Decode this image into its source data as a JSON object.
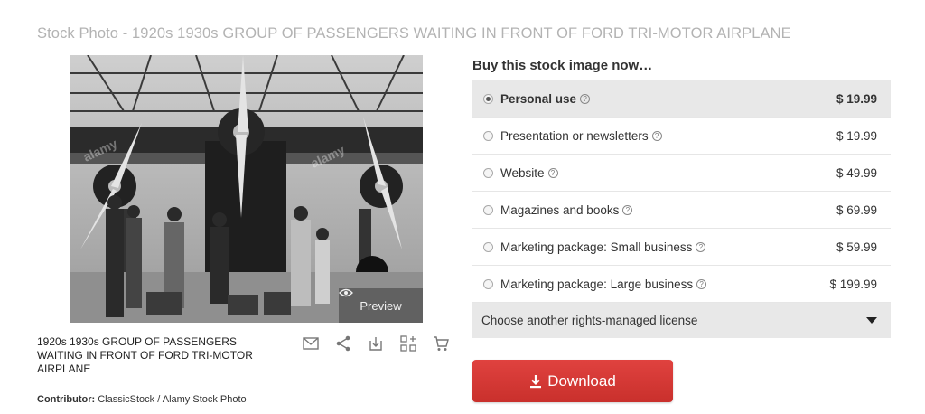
{
  "page": {
    "title": "Stock Photo - 1920s 1930s GROUP OF PASSENGERS WAITING IN FRONT OF FORD TRI-MOTOR AIRPLANE"
  },
  "photo": {
    "watermark": "alamy",
    "preview_label": "Preview"
  },
  "caption": "1920s 1930s GROUP OF PASSENGERS WAITING IN FRONT OF FORD TRI-MOTOR AIRPLANE",
  "contributor": {
    "label": "Contributor:",
    "value": "ClassicStock / Alamy Stock Photo"
  },
  "actions": [
    {
      "name": "email-icon"
    },
    {
      "name": "share-icon"
    },
    {
      "name": "download-comp-icon"
    },
    {
      "name": "add-to-lightbox-icon"
    },
    {
      "name": "cart-icon"
    }
  ],
  "buy": {
    "heading": "Buy this stock image now…",
    "licenses": [
      {
        "label": "Personal use",
        "price": "$ 19.99",
        "selected": true
      },
      {
        "label": "Presentation or newsletters",
        "price": "$ 19.99",
        "selected": false
      },
      {
        "label": "Website",
        "price": "$ 49.99",
        "selected": false
      },
      {
        "label": "Magazines and books",
        "price": "$ 69.99",
        "selected": false
      },
      {
        "label": "Marketing package: Small business",
        "price": "$ 59.99",
        "selected": false
      },
      {
        "label": "Marketing package: Large business",
        "price": "$ 199.99",
        "selected": false
      }
    ],
    "rights_label": "Choose another rights-managed license",
    "download_label": "Download"
  },
  "colors": {
    "download": "#d9363e",
    "selected_row": "#e8e8e8"
  }
}
